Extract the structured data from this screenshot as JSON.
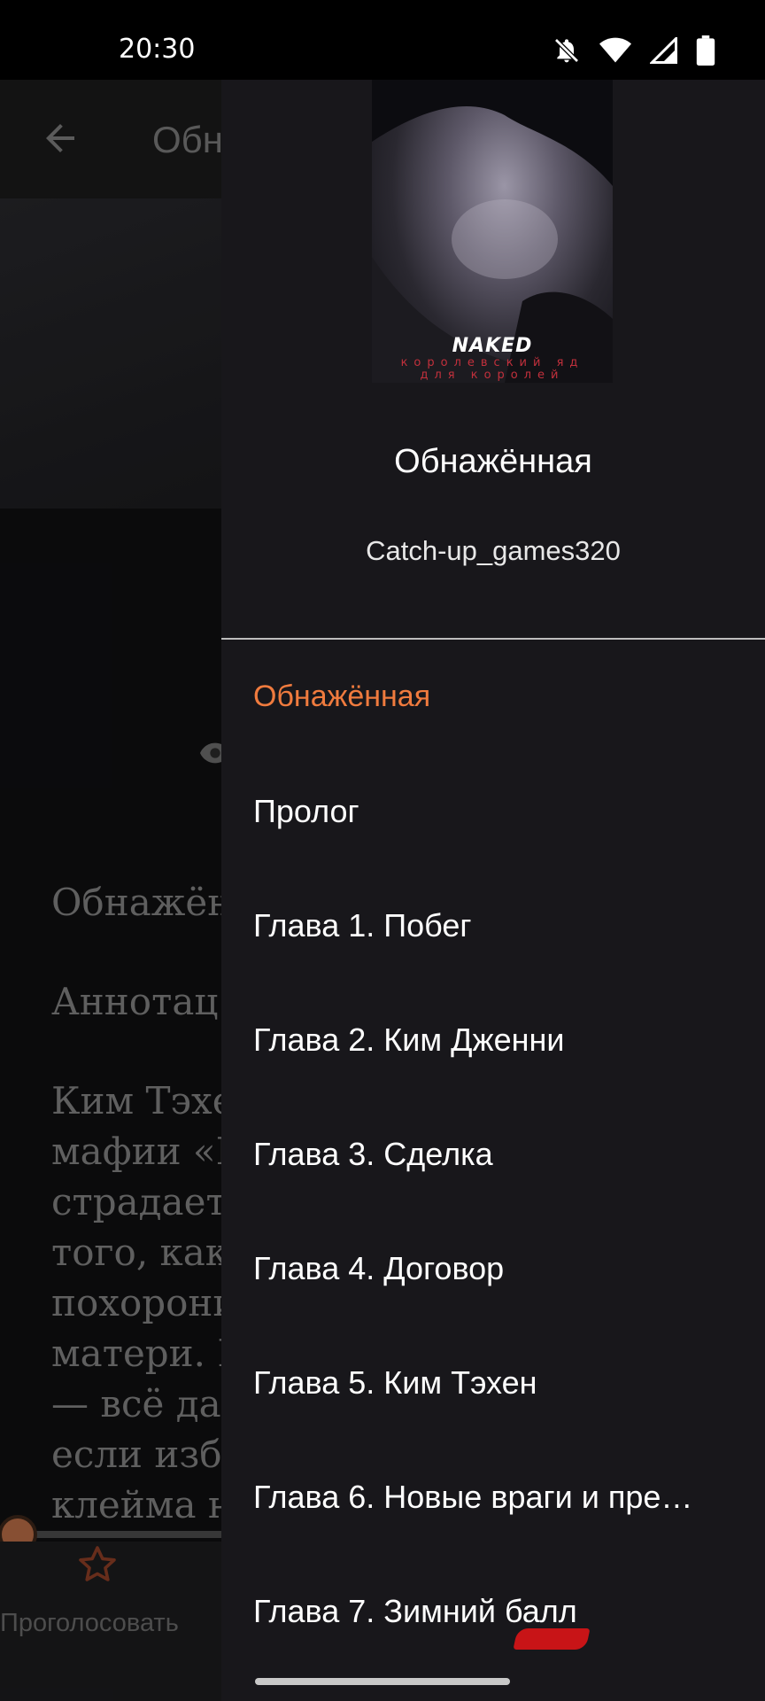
{
  "status_bar": {
    "time": "20:30",
    "icons": [
      "bell-off-icon",
      "wifi-icon",
      "signal-icon",
      "battery-icon"
    ]
  },
  "reader": {
    "appbar_title": "Обн",
    "lines": [
      "Обнажён",
      "Аннотац",
      "Ким Тэхе",
      "мафии «I",
      "страдает",
      "того, как",
      "похорони",
      "матери. I",
      "— всё дан",
      "если изба",
      "клейма н"
    ],
    "vote_label": "Проголосовать"
  },
  "drawer": {
    "cover": {
      "title": "NAKED",
      "subtitle_line1": "королевский яд",
      "subtitle_line2": "для королей"
    },
    "book_title": "Обнажённая",
    "author": "Catch-up_games320",
    "toc": [
      "Обнажённая",
      "Пролог",
      "Глава 1. Побег",
      "Глава 2. Ким Дженни",
      "Глава 3. Сделка",
      "Глава 4. Договор",
      "Глава 5. Ким Тэхен",
      "Глава 6. Новые враги и пре…",
      "Глава 7. Зимний балл"
    ]
  },
  "colors": {
    "accent": "#f07b3e",
    "drawer_bg": "#18171b",
    "status_bar_bg": "#000000"
  }
}
